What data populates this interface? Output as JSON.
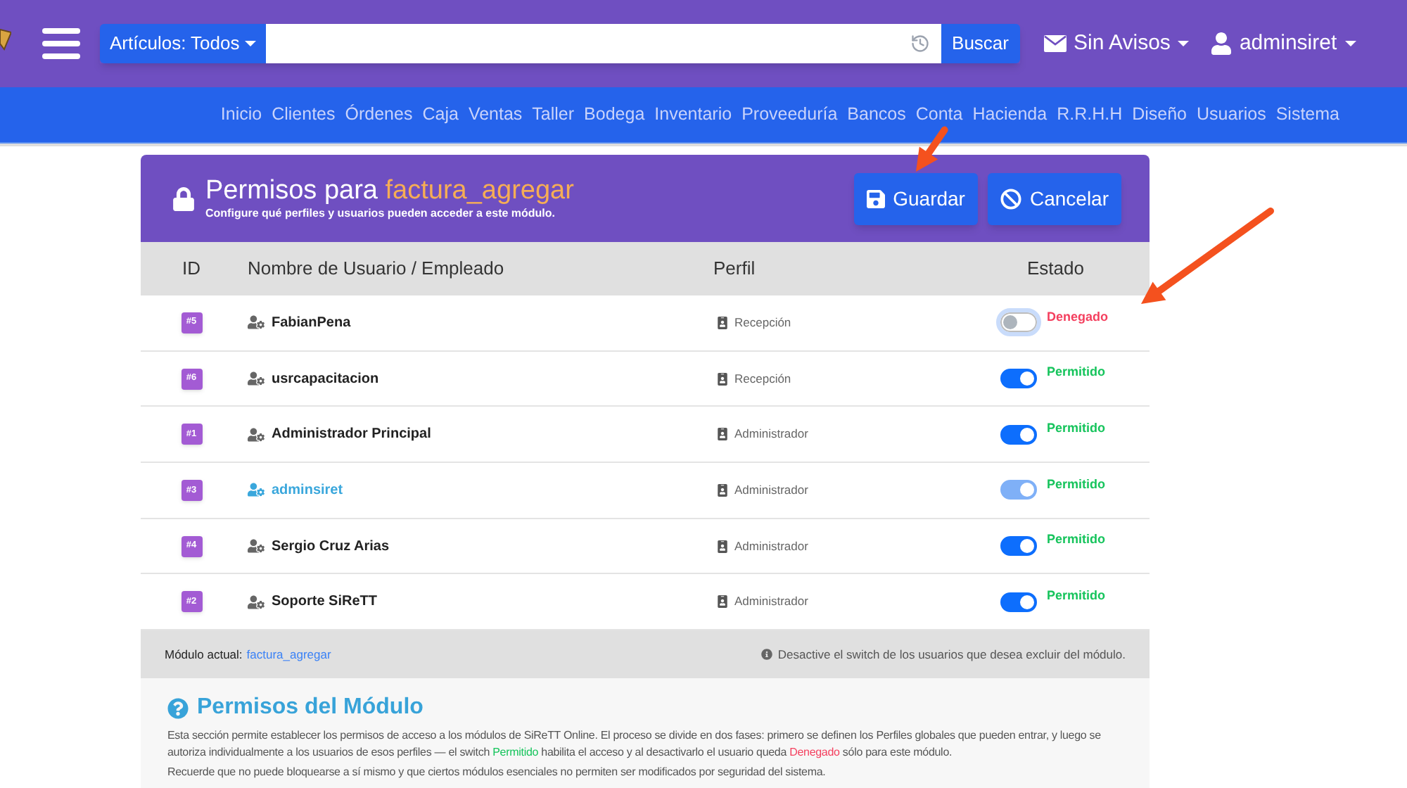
{
  "top_bar": {
    "search_scope": "Artículos: Todos",
    "search_button": "Buscar",
    "notifications": "Sin Avisos",
    "user": "adminsiret"
  },
  "nav": [
    "Inicio",
    "Clientes",
    "Órdenes",
    "Caja",
    "Ventas",
    "Taller",
    "Bodega",
    "Inventario",
    "Proveeduría",
    "Bancos",
    "Conta",
    "Hacienda",
    "R.R.H.H",
    "Diseño",
    "Usuarios",
    "Sistema"
  ],
  "panel": {
    "title": "Permisos para",
    "module": "factura_agregar",
    "subtitle": "Configure qué perfiles y usuarios pueden acceder a este módulo.",
    "buttons": [
      {
        "kind": "save",
        "label": "Guardar"
      },
      {
        "kind": "cancel",
        "label": "Cancelar"
      }
    ]
  },
  "table": {
    "columns": [
      "ID",
      "Nombre de Usuario / Empleado",
      "Perfil",
      "Estado"
    ],
    "rows": [
      {
        "id": "#5",
        "name": "FabianPena",
        "current": false,
        "profile": "Recepción",
        "on": false,
        "focused": true,
        "disabled": false,
        "status": "Denegado"
      },
      {
        "id": "#6",
        "name": "usrcapacitacion",
        "current": false,
        "profile": "Recepción",
        "on": true,
        "focused": false,
        "disabled": false,
        "status": "Permitido"
      },
      {
        "id": "#1",
        "name": "Administrador Principal",
        "current": false,
        "profile": "Administrador",
        "on": true,
        "focused": false,
        "disabled": false,
        "status": "Permitido"
      },
      {
        "id": "#3",
        "name": "adminsiret",
        "current": true,
        "profile": "Administrador",
        "on": true,
        "focused": false,
        "disabled": true,
        "status": "Permitido"
      },
      {
        "id": "#4",
        "name": "Sergio Cruz Arias",
        "current": false,
        "profile": "Administrador",
        "on": true,
        "focused": false,
        "disabled": false,
        "status": "Permitido"
      },
      {
        "id": "#2",
        "name": "Soporte SiReTT",
        "current": false,
        "profile": "Administrador",
        "on": true,
        "focused": false,
        "disabled": false,
        "status": "Permitido"
      }
    ]
  },
  "footer": {
    "label": "Módulo actual:",
    "module": "factura_agregar",
    "hint": "Desactive el switch de los usuarios que desea excluir del módulo."
  },
  "help": {
    "title": "Permisos del Módulo",
    "paragraph": [
      {
        "kind": "plain",
        "text": "Esta sección permite establecer los permisos de acceso a los módulos de SiReTT Online. El proceso se divide en dos fases: primero se definen los Perfiles globales que pueden entrar, y luego se autoriza individualmente a los usuarios de esos perfiles — el switch"
      },
      {
        "kind": "allowed",
        "text": "Permitido"
      },
      {
        "kind": "plain",
        "text": "habilita el acceso y al desactivarlo el usuario queda"
      },
      {
        "kind": "denied",
        "text": "Denegado"
      },
      {
        "kind": "plain",
        "text": "sólo para este módulo."
      }
    ],
    "note": "Recuerde que no puede bloquearse a sí mismo y que ciertos módulos esenciales no permiten ser modificados por seguridad del sistema."
  },
  "annotations": [
    {
      "kind": "arrow"
    },
    {
      "kind": "arrow"
    }
  ]
}
